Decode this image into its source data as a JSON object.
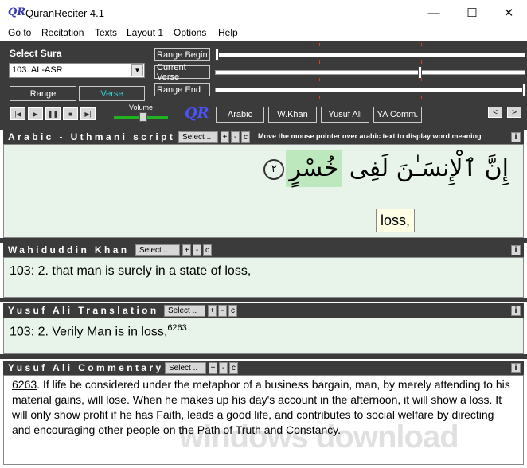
{
  "window": {
    "title": "QuranReciter 4.1",
    "icon": "QR",
    "min": "—",
    "max": "☐",
    "close": "✕"
  },
  "menu": [
    "Go to",
    "Recitation",
    "Texts",
    "Layout 1",
    "Options",
    "Help"
  ],
  "controls": {
    "select_sura_label": "Select Sura",
    "sura_value": "103. AL-ASR",
    "range_label": "Range",
    "verse_label": "Verse",
    "volume_label": "Volume",
    "volume_level": 0.55,
    "range_begin": "Range Begin",
    "current_verse": "Current Verse",
    "range_end": "Range End",
    "range_begin_pos": 0.0,
    "current_verse_pos": 0.66,
    "range_end_pos": 1.0,
    "logo": "QR",
    "translations": [
      "Arabic",
      "W.Khan",
      "Yusuf Ali",
      "YA Comm."
    ],
    "prev": "<",
    "next": ">",
    "transport": [
      "|◀",
      "▶",
      "❚❚",
      "■",
      "▶|"
    ]
  },
  "panels": {
    "arabic": {
      "title": "Arabic - Uthmani script",
      "select": "Select ..",
      "hint": "Move the mouse pointer over arabic text to display word meaning",
      "text_before": "إِنَّ ٱلْإِنسَـٰنَ لَفِى ",
      "word": "خُسْرٍ",
      "verse_no": "٢",
      "tooltip": "loss,"
    },
    "wkhan": {
      "title": "Wahiduddin Khan",
      "select": "Select ..",
      "text": "103: 2. that man is surely in a state of loss,"
    },
    "yusuf": {
      "title": "Yusuf Ali Translation",
      "select": "Select ..",
      "text": "103: 2. Verily Man is in loss,",
      "sup": "6263"
    },
    "comm": {
      "title": "Yusuf Ali Commentary",
      "select": "Select ..",
      "ref": "6263",
      "text": ". If life be considered under the metaphor of a business bargain, man, by merely attending to his material gains, will lose. When he makes up his day's account in the afternoon, it will show a loss. It will only show profit if he has Faith, leads a good life, and contributes to social welfare by directing and encouraging other people on the Path of Truth and Constancy."
    }
  },
  "buttons": {
    "plus": "+",
    "minus": "-",
    "c": "c",
    "info": "i"
  },
  "watermark": "windows download"
}
